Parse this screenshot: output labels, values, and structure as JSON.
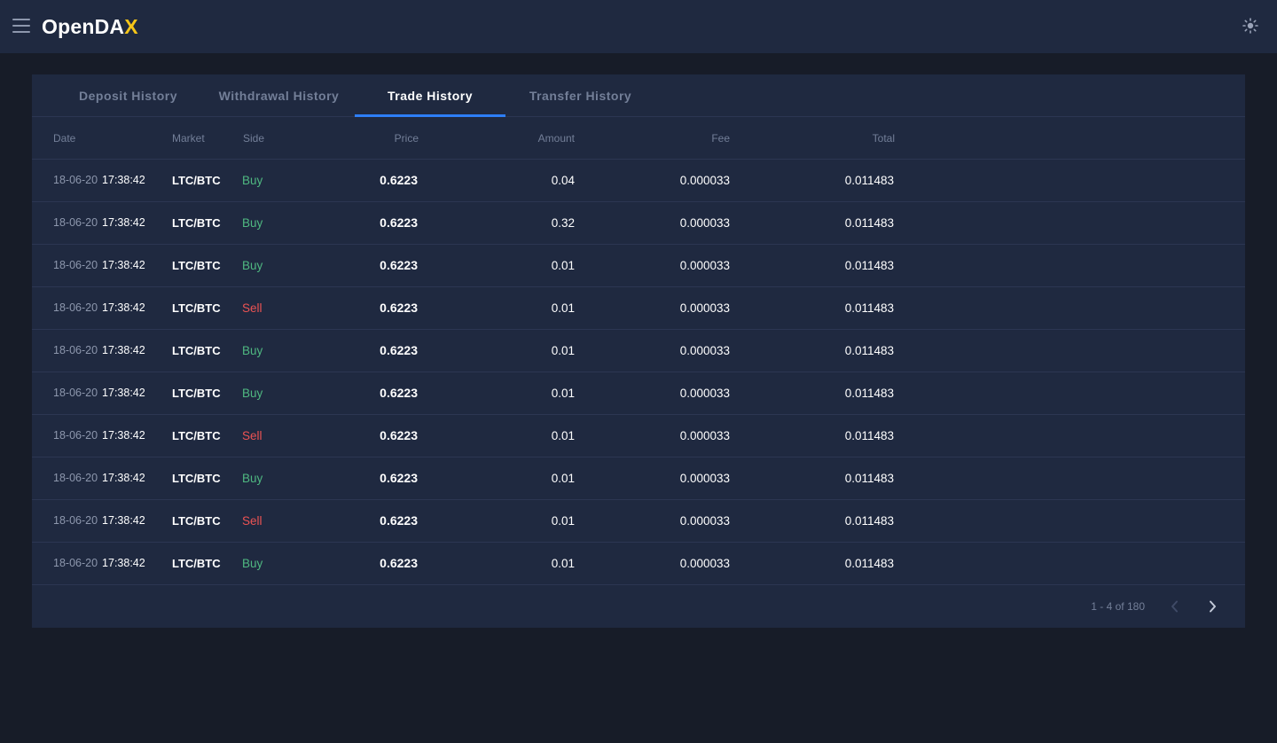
{
  "header": {
    "logo_text": "OpenDA",
    "logo_accent": "X",
    "accent_color": "#f5c518",
    "menu_icon": "hamburger-menu-icon",
    "theme_icon": "sun-icon"
  },
  "tabs": [
    {
      "label": "Deposit History",
      "active": false
    },
    {
      "label": "Withdrawal History",
      "active": false
    },
    {
      "label": "Trade History",
      "active": true
    },
    {
      "label": "Transfer History",
      "active": false
    }
  ],
  "table": {
    "columns": [
      "Date",
      "Market",
      "Side",
      "Price",
      "Amount",
      "Fee",
      "Total"
    ],
    "side_colors": {
      "Buy": "#4fb881",
      "Sell": "#ec5353"
    },
    "rows": [
      {
        "date": "18-06-20",
        "time": "17:38:42",
        "market": "LTC/BTC",
        "side": "Buy",
        "price": "0.6223",
        "amount": "0.04",
        "fee": "0.000033",
        "total": "0.011483"
      },
      {
        "date": "18-06-20",
        "time": "17:38:42",
        "market": "LTC/BTC",
        "side": "Buy",
        "price": "0.6223",
        "amount": "0.32",
        "fee": "0.000033",
        "total": "0.011483"
      },
      {
        "date": "18-06-20",
        "time": "17:38:42",
        "market": "LTC/BTC",
        "side": "Buy",
        "price": "0.6223",
        "amount": "0.01",
        "fee": "0.000033",
        "total": "0.011483"
      },
      {
        "date": "18-06-20",
        "time": "17:38:42",
        "market": "LTC/BTC",
        "side": "Sell",
        "price": "0.6223",
        "amount": "0.01",
        "fee": "0.000033",
        "total": "0.011483"
      },
      {
        "date": "18-06-20",
        "time": "17:38:42",
        "market": "LTC/BTC",
        "side": "Buy",
        "price": "0.6223",
        "amount": "0.01",
        "fee": "0.000033",
        "total": "0.011483"
      },
      {
        "date": "18-06-20",
        "time": "17:38:42",
        "market": "LTC/BTC",
        "side": "Buy",
        "price": "0.6223",
        "amount": "0.01",
        "fee": "0.000033",
        "total": "0.011483"
      },
      {
        "date": "18-06-20",
        "time": "17:38:42",
        "market": "LTC/BTC",
        "side": "Sell",
        "price": "0.6223",
        "amount": "0.01",
        "fee": "0.000033",
        "total": "0.011483"
      },
      {
        "date": "18-06-20",
        "time": "17:38:42",
        "market": "LTC/BTC",
        "side": "Buy",
        "price": "0.6223",
        "amount": "0.01",
        "fee": "0.000033",
        "total": "0.011483"
      },
      {
        "date": "18-06-20",
        "time": "17:38:42",
        "market": "LTC/BTC",
        "side": "Sell",
        "price": "0.6223",
        "amount": "0.01",
        "fee": "0.000033",
        "total": "0.011483"
      },
      {
        "date": "18-06-20",
        "time": "17:38:42",
        "market": "LTC/BTC",
        "side": "Buy",
        "price": "0.6223",
        "amount": "0.01",
        "fee": "0.000033",
        "total": "0.011483"
      }
    ]
  },
  "pagination": {
    "text": "1 - 4 of 180",
    "prev_icon": "chevron-left-icon",
    "next_icon": "chevron-right-icon"
  }
}
